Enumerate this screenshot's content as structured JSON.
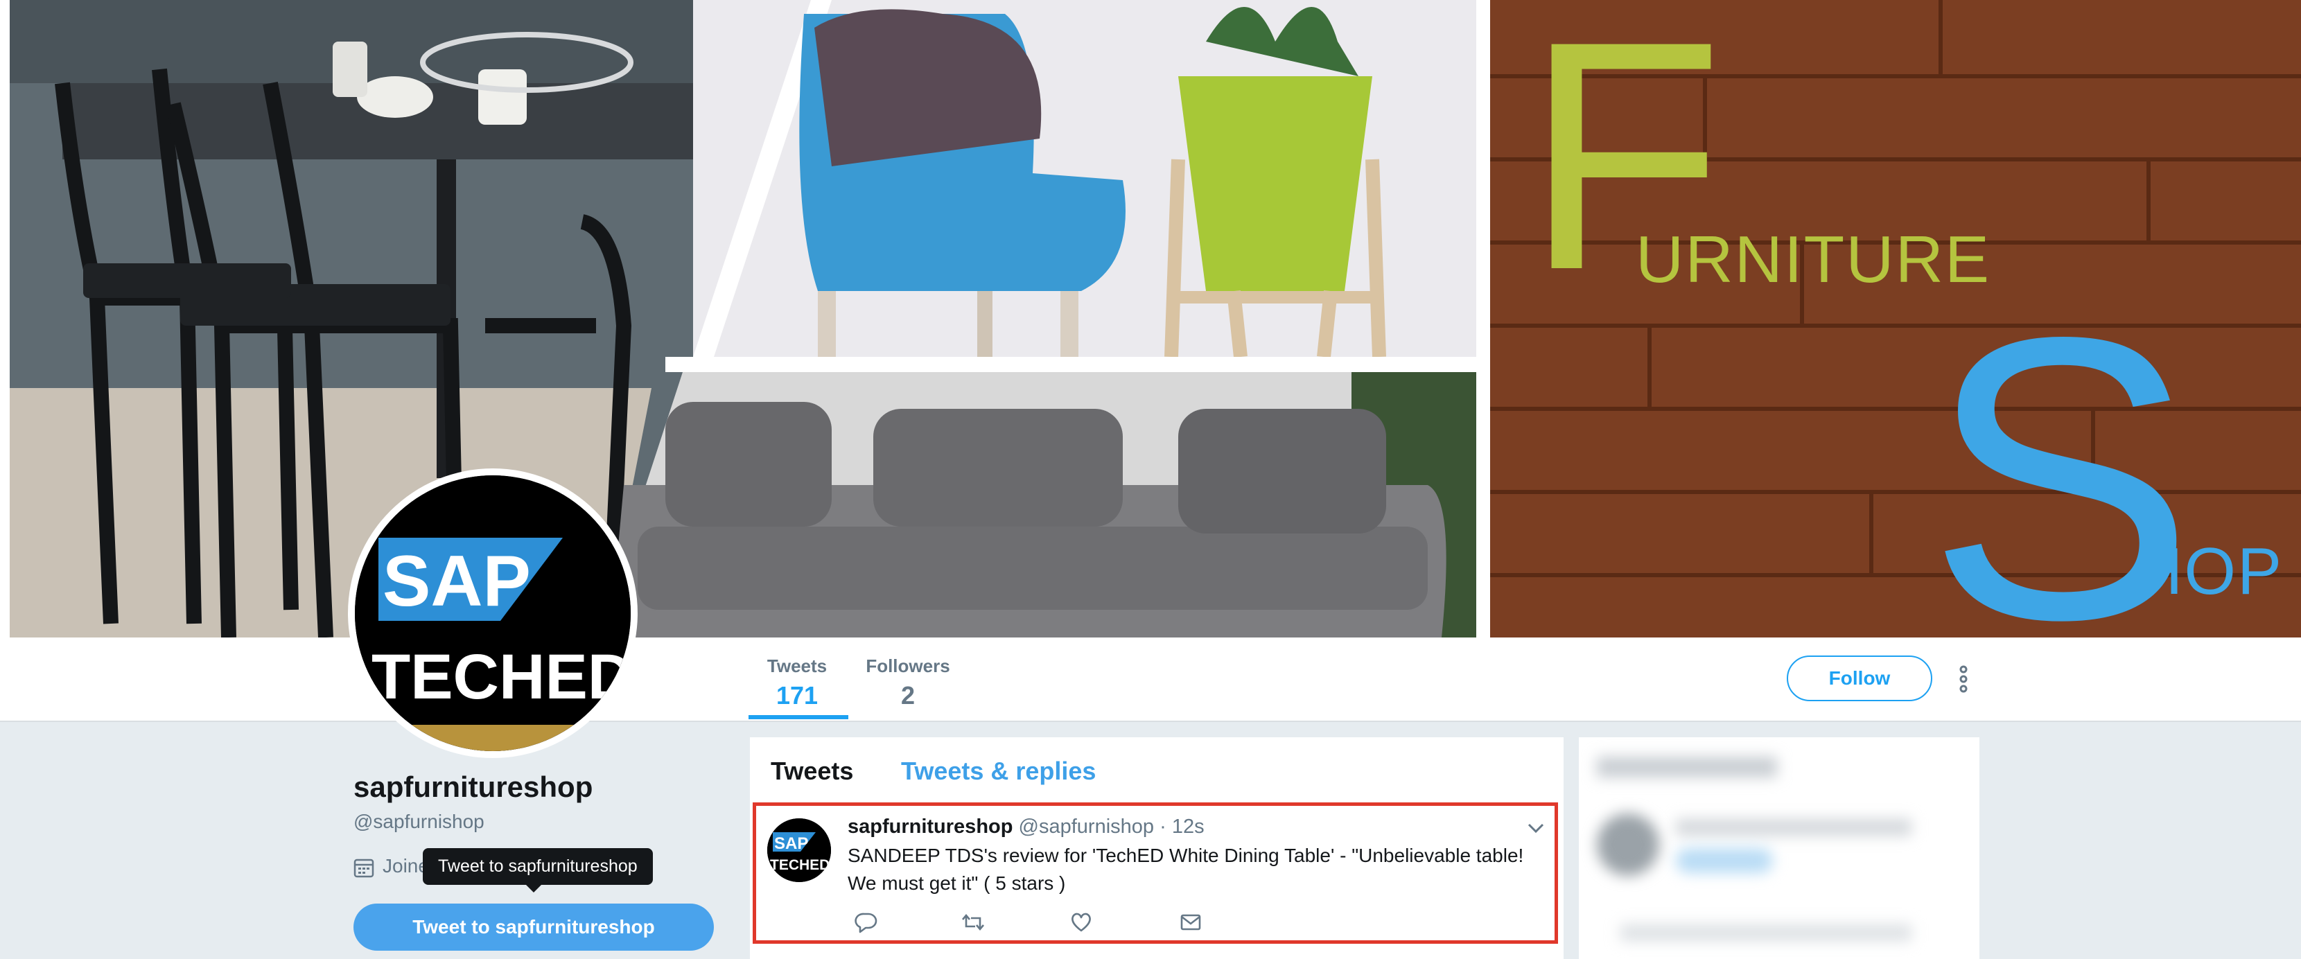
{
  "banner": {
    "logo": {
      "first_letter_1": "F",
      "rest_1": "URNITURE",
      "first_letter_2": "S",
      "rest_2": "HOP"
    }
  },
  "nav": {
    "stats": [
      {
        "label": "Tweets",
        "value": "171"
      },
      {
        "label": "Followers",
        "value": "2"
      }
    ],
    "follow_label": "Follow",
    "more_icon": "vertical-dots-icon"
  },
  "avatar": {
    "brand_top": "SAP",
    "brand_bottom": "TECHED"
  },
  "profile": {
    "name": "sapfurnitureshop",
    "handle": "@sapfurnishop",
    "joined_partial": "Joine",
    "calendar_icon": "calendar-icon",
    "tooltip": "Tweet to sapfurnitureshop",
    "tweet_to_label": "Tweet to sapfurnitureshop"
  },
  "timeline": {
    "tabs": [
      {
        "label": "Tweets",
        "active": true
      },
      {
        "label": "Tweets & replies",
        "active": false
      }
    ],
    "tweet": {
      "name": "sapfurnitureshop",
      "handle": "@sapfurnishop",
      "dot": "·",
      "time": "12s",
      "text": "SANDEEP TDS's review for 'TechED White Dining Table' -  \"Unbelievable table! We must get it\" ( 5 stars )",
      "avatar_top": "SAP",
      "avatar_bottom": "TECHED",
      "actions": [
        "reply-icon",
        "retweet-icon",
        "like-icon",
        "dm-icon"
      ],
      "highlight_color": "#e0382b"
    }
  },
  "colors": {
    "accent": "#1da1f2",
    "page_bg": "#e6ecf0",
    "logo_green": "#b5c43f",
    "logo_blue": "#3ea6e6"
  }
}
